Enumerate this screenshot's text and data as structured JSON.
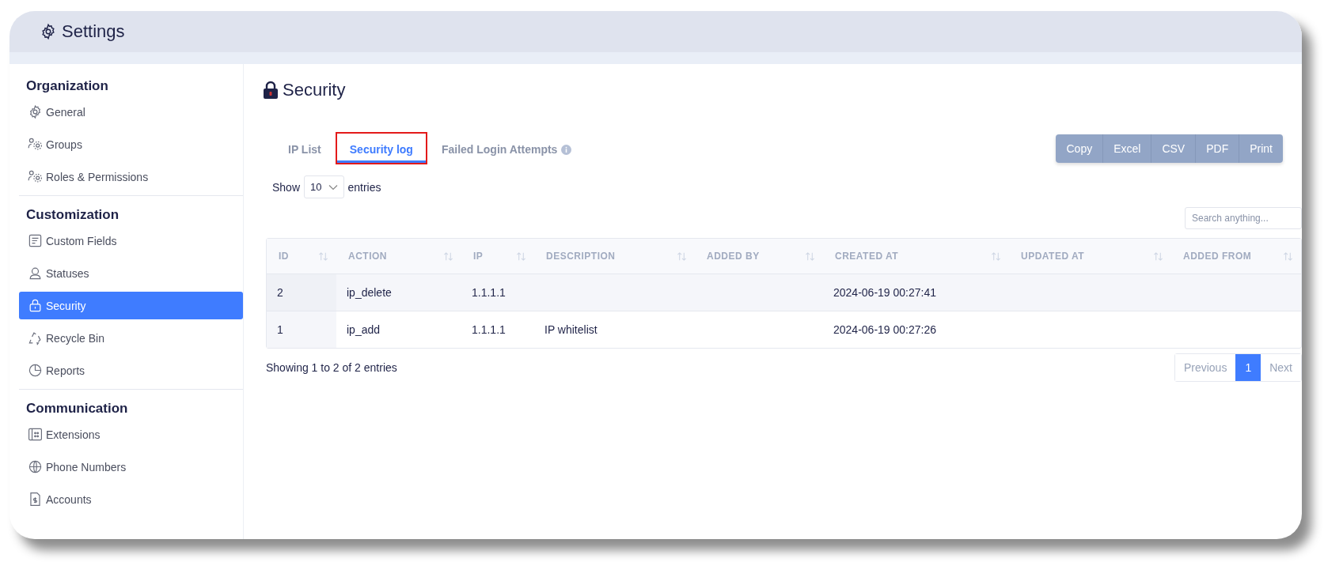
{
  "header": {
    "title": "Settings"
  },
  "sidebar": {
    "sections": [
      {
        "title": "Organization",
        "items": [
          {
            "label": "General",
            "selected": false
          },
          {
            "label": "Groups",
            "selected": false
          },
          {
            "label": "Roles & Permissions",
            "selected": false
          }
        ]
      },
      {
        "title": "Customization",
        "items": [
          {
            "label": "Custom Fields",
            "selected": false
          },
          {
            "label": "Statuses",
            "selected": false
          },
          {
            "label": "Security",
            "selected": true
          },
          {
            "label": "Recycle Bin",
            "selected": false
          },
          {
            "label": "Reports",
            "selected": false
          }
        ]
      },
      {
        "title": "Communication",
        "items": [
          {
            "label": "Extensions",
            "selected": false
          },
          {
            "label": "Phone Numbers",
            "selected": false
          },
          {
            "label": "Accounts",
            "selected": false
          }
        ]
      }
    ]
  },
  "page": {
    "title": "Security"
  },
  "tabs": [
    {
      "label": "IP List",
      "selected": false,
      "highlighted": false,
      "info": false
    },
    {
      "label": "Security log",
      "selected": true,
      "highlighted": true,
      "info": false
    },
    {
      "label": "Failed Login Attempts",
      "selected": false,
      "highlighted": false,
      "info": true
    }
  ],
  "export_buttons": [
    "Copy",
    "Excel",
    "CSV",
    "PDF",
    "Print"
  ],
  "length": {
    "before": "Show",
    "value": "10",
    "after": "entries"
  },
  "search": {
    "placeholder": "Search anything..."
  },
  "table": {
    "columns": [
      "ID",
      "ACTION",
      "IP",
      "DESCRIPTION",
      "ADDED BY",
      "CREATED AT",
      "UPDATED AT",
      "ADDED FROM"
    ],
    "rows": [
      [
        "2",
        "ip_delete",
        "1.1.1.1",
        "",
        "",
        "2024-06-19 00:27:41",
        "",
        ""
      ],
      [
        "1",
        "ip_add",
        "1.1.1.1",
        "IP whitelist",
        "",
        "2024-06-19 00:27:26",
        "",
        ""
      ]
    ]
  },
  "info": "Showing 1 to 2 of 2 entries",
  "pagination": [
    {
      "label": "Previous",
      "selected": false
    },
    {
      "label": "1",
      "selected": true
    },
    {
      "label": "Next",
      "selected": false
    }
  ]
}
